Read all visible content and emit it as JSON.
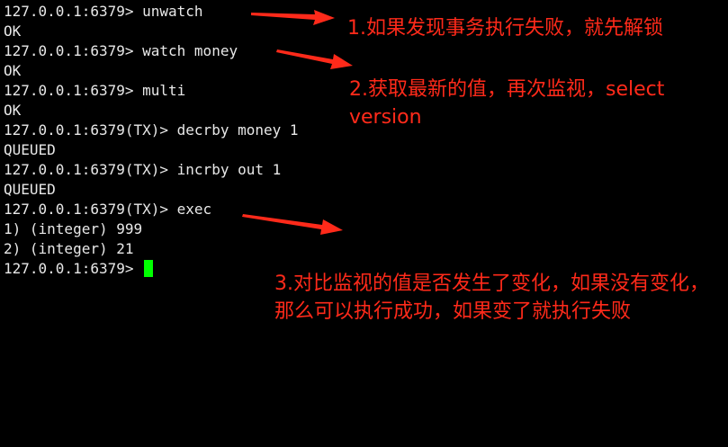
{
  "terminal": {
    "lines": [
      "127.0.0.1:6379> unwatch",
      "OK",
      "127.0.0.1:6379> watch money",
      "OK",
      "127.0.0.1:6379> multi",
      "OK",
      "127.0.0.1:6379(TX)> decrby money 1",
      "QUEUED",
      "127.0.0.1:6379(TX)> incrby out 1",
      "QUEUED",
      "127.0.0.1:6379(TX)> exec",
      "1) (integer) 999",
      "2) (integer) 21",
      "127.0.0.1:6379> "
    ]
  },
  "annotations": {
    "note1": "1.如果发现事务执行失败，就先解锁",
    "note2": "2.获取最新的值，再次监视，select version",
    "note3": "3.对比监视的值是否发生了变化，如果没有变化，那么可以执行成功，如果变了就执行失败"
  },
  "colors": {
    "background": "#000000",
    "text": "#e8e8e8",
    "cursor": "#00ff00",
    "annotation": "#ff2a1a"
  }
}
